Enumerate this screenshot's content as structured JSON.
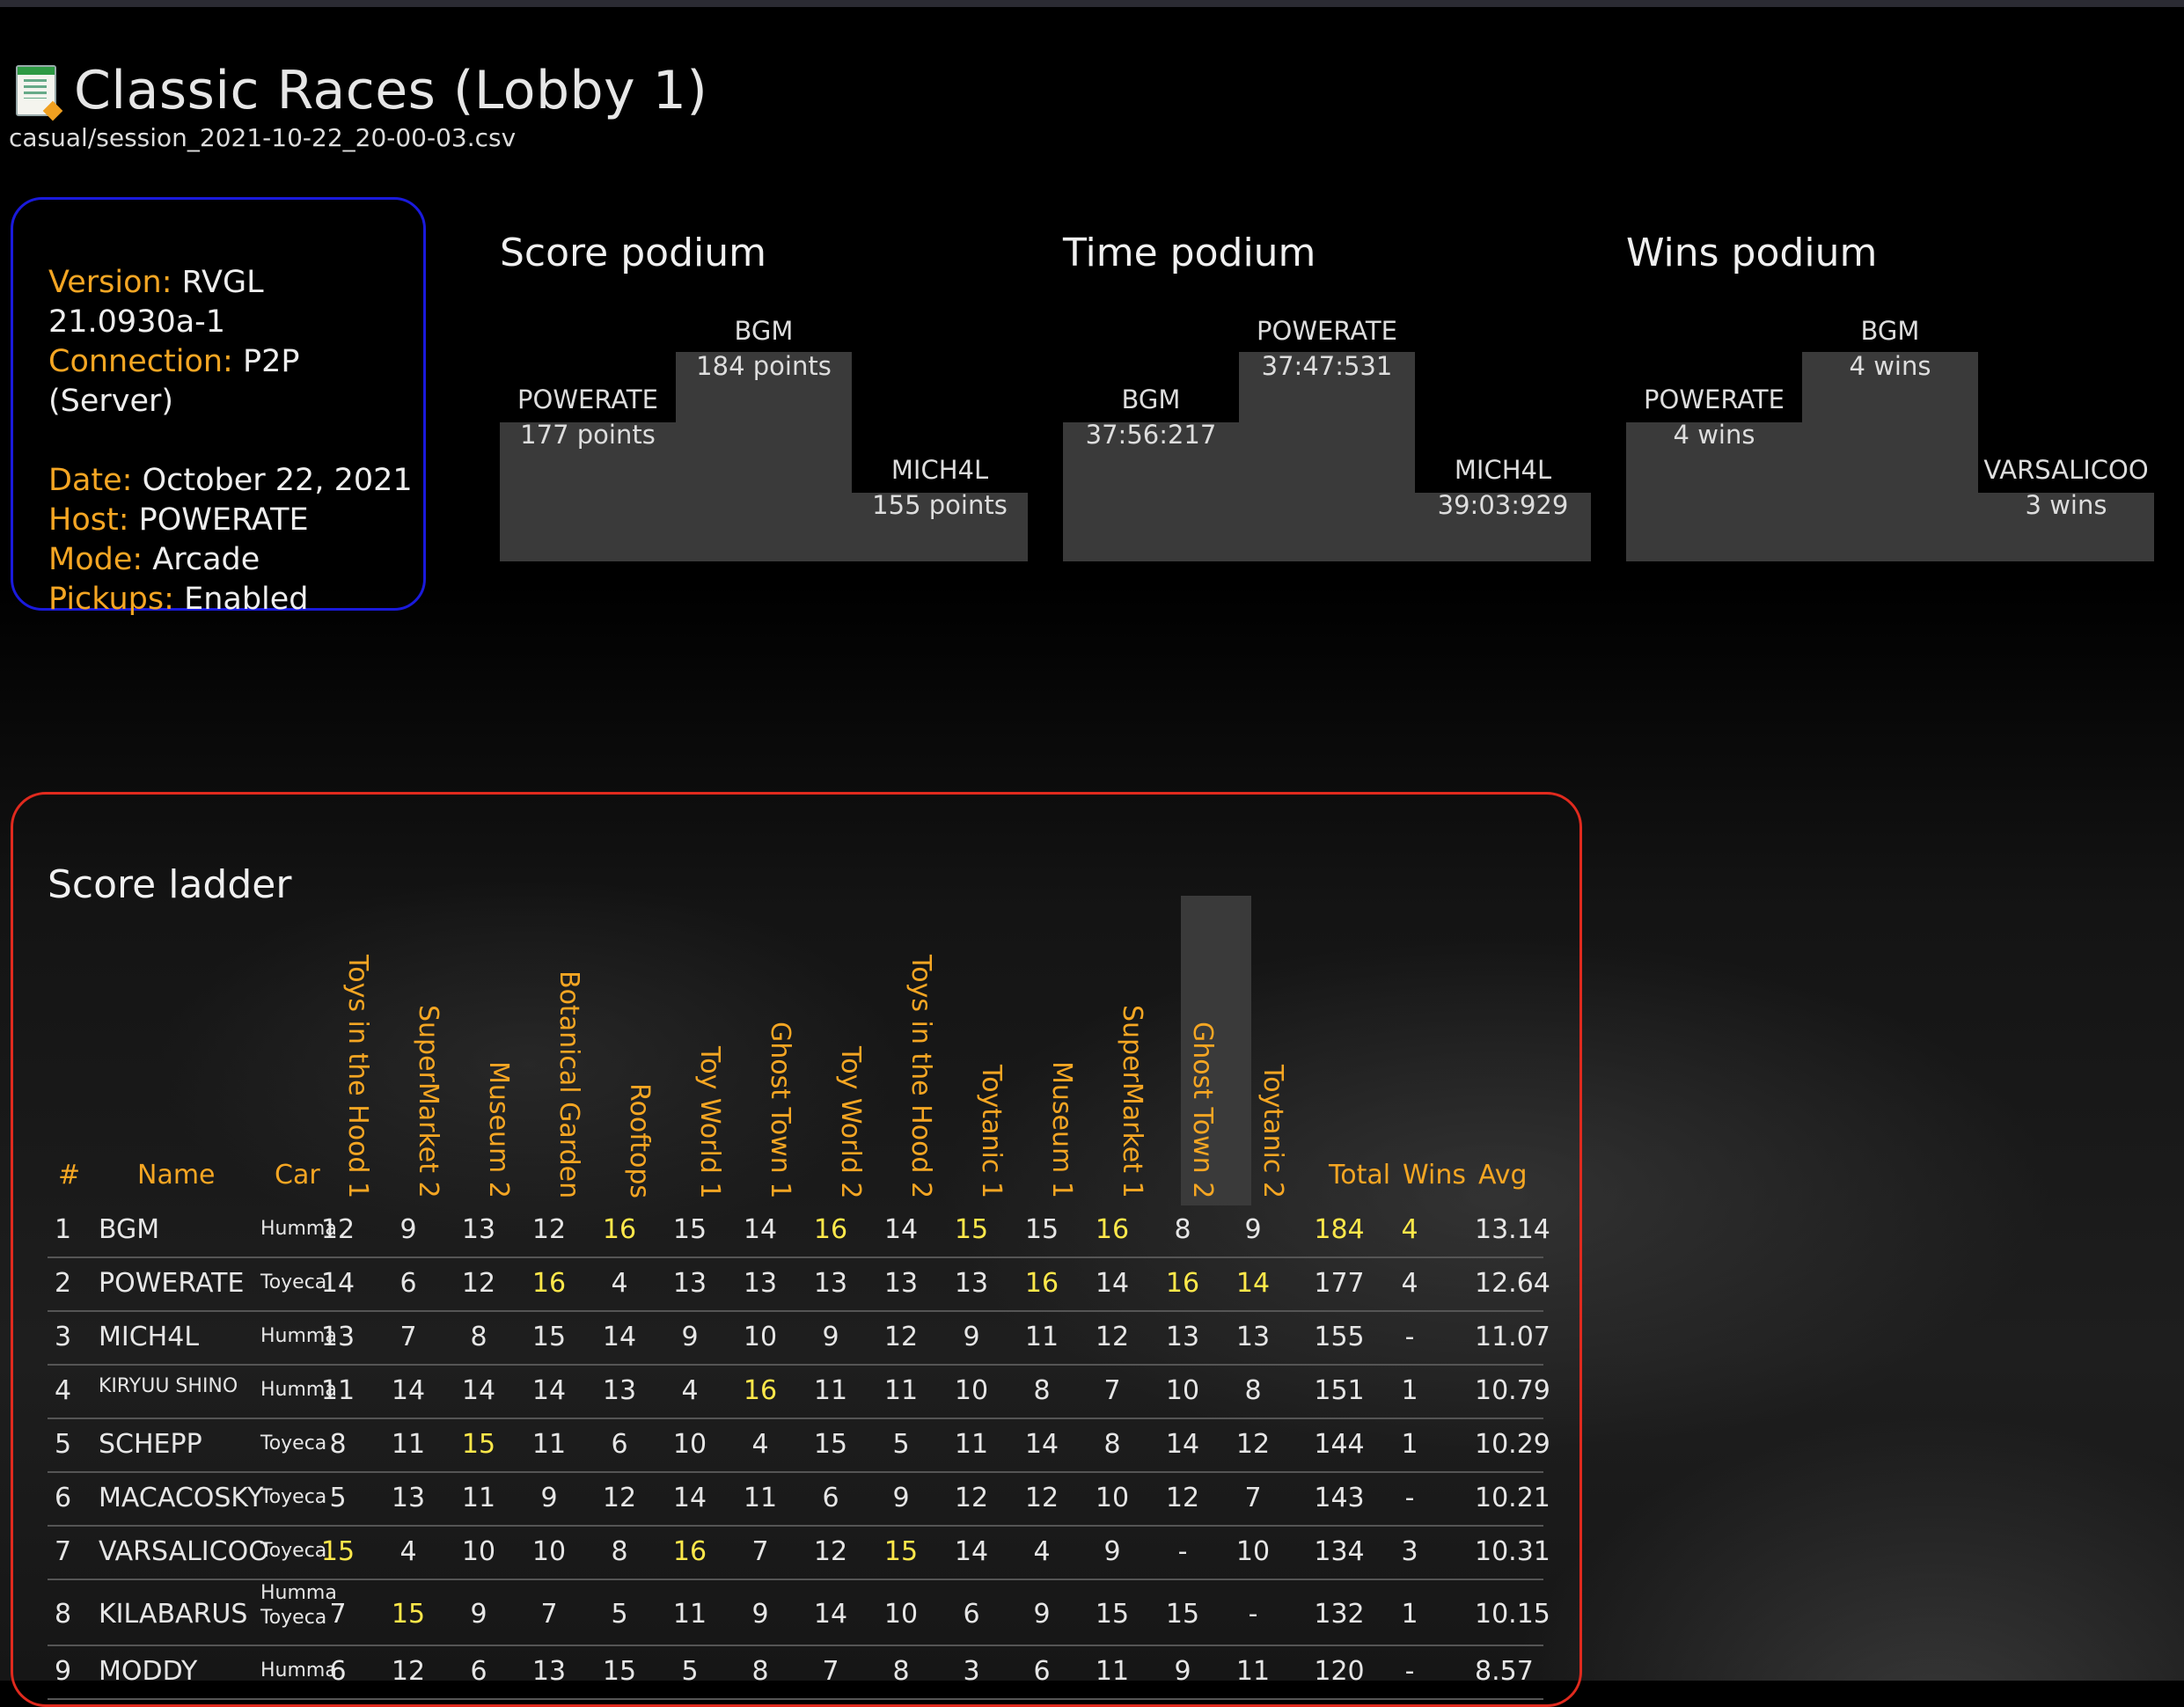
{
  "header": {
    "title": "Classic Races (Lobby 1)",
    "file_path": "casual/session_2021-10-22_20-00-03.csv",
    "file_icon": "spreadsheet-icon"
  },
  "info": {
    "version_label": "Version:",
    "version": "RVGL 21.0930a-1",
    "connection_label": "Connection:",
    "connection": "P2P (Server)",
    "date_label": "Date:",
    "date": "October 22, 2021",
    "host_label": "Host:",
    "host": "POWERATE",
    "mode_label": "Mode:",
    "mode": "Arcade",
    "pickups_label": "Pickups:",
    "pickups": "Enabled"
  },
  "podiums": {
    "score": {
      "title": "Score podium",
      "first": {
        "name": "BGM",
        "value": "184 points"
      },
      "second": {
        "name": "POWERATE",
        "value": "177 points"
      },
      "third": {
        "name": "MICH4L",
        "value": "155 points"
      }
    },
    "time": {
      "title": "Time podium",
      "first": {
        "name": "POWERATE",
        "value": "37:47:531"
      },
      "second": {
        "name": "BGM",
        "value": "37:56:217"
      },
      "third": {
        "name": "MICH4L",
        "value": "39:03:929"
      }
    },
    "wins": {
      "title": "Wins podium",
      "first": {
        "name": "BGM",
        "value": "4 wins"
      },
      "second": {
        "name": "POWERATE",
        "value": "4 wins"
      },
      "third": {
        "name": "VARSALICOO",
        "value": "3 wins"
      }
    }
  },
  "ladder": {
    "title": "Score ladder",
    "headers": {
      "rank": "#",
      "name": "Name",
      "car": "Car",
      "total": "Total",
      "wins": "Wins",
      "avg": "Avg"
    },
    "tracks": [
      "Toys in the Hood 1",
      "SuperMarket 2",
      "Museum 2",
      "Botanical Garden",
      "Rooftops",
      "Toy World 1",
      "Ghost Town 1",
      "Toy World 2",
      "Toys in the Hood 2",
      "Toytanic 1",
      "Museum 1",
      "SuperMarket 1",
      "Ghost Town 2",
      "Toytanic 2"
    ],
    "highlight_color": "#ffe84a",
    "rows": [
      {
        "rank": "1",
        "name": "BGM",
        "car": "Humma",
        "car2": "",
        "scores": [
          "12",
          "9",
          "13",
          "12",
          "16",
          "15",
          "14",
          "16",
          "14",
          "15",
          "15",
          "16",
          "8",
          "9"
        ],
        "hi": [
          4,
          7,
          9,
          11
        ],
        "total": "184",
        "wins": "4",
        "avg": "13.14",
        "total_hi": true
      },
      {
        "rank": "2",
        "name": "POWERATE",
        "car": "Toyeca",
        "car2": "",
        "scores": [
          "14",
          "6",
          "12",
          "16",
          "4",
          "13",
          "13",
          "13",
          "13",
          "13",
          "16",
          "14",
          "16",
          "14"
        ],
        "hi": [
          3,
          10,
          12,
          13
        ],
        "total": "177",
        "wins": "4",
        "avg": "12.64",
        "total_hi": false
      },
      {
        "rank": "3",
        "name": "MICH4L",
        "car": "Humma",
        "car2": "",
        "scores": [
          "13",
          "7",
          "8",
          "15",
          "14",
          "9",
          "10",
          "9",
          "12",
          "9",
          "11",
          "12",
          "13",
          "13"
        ],
        "hi": [],
        "total": "155",
        "wins": "-",
        "avg": "11.07",
        "total_hi": false
      },
      {
        "rank": "4",
        "name": "KIRYUU SHINO",
        "car": "Humma",
        "car2": "",
        "scores": [
          "11",
          "14",
          "14",
          "14",
          "13",
          "4",
          "16",
          "11",
          "11",
          "10",
          "8",
          "7",
          "10",
          "8"
        ],
        "hi": [
          6
        ],
        "total": "151",
        "wins": "1",
        "avg": "10.79",
        "total_hi": false
      },
      {
        "rank": "5",
        "name": "SCHEPP",
        "car": "Toyeca",
        "car2": "",
        "scores": [
          "8",
          "11",
          "15",
          "11",
          "6",
          "10",
          "4",
          "15",
          "5",
          "11",
          "14",
          "8",
          "14",
          "12"
        ],
        "hi": [
          2
        ],
        "total": "144",
        "wins": "1",
        "avg": "10.29",
        "total_hi": false
      },
      {
        "rank": "6",
        "name": "MACACOSKY",
        "car": "Toyeca",
        "car2": "",
        "scores": [
          "5",
          "13",
          "11",
          "9",
          "12",
          "14",
          "11",
          "6",
          "9",
          "12",
          "12",
          "10",
          "12",
          "7"
        ],
        "hi": [],
        "total": "143",
        "wins": "-",
        "avg": "10.21",
        "total_hi": false
      },
      {
        "rank": "7",
        "name": "VARSALICOO",
        "car": "Toyeca",
        "car2": "",
        "scores": [
          "15",
          "4",
          "10",
          "10",
          "8",
          "16",
          "7",
          "12",
          "15",
          "14",
          "4",
          "9",
          "-",
          "10"
        ],
        "hi": [
          0,
          5,
          8
        ],
        "total": "134",
        "wins": "3",
        "avg": "10.31",
        "total_hi": false
      },
      {
        "rank": "8",
        "name": "KILABARUS",
        "car": "Humma",
        "car2": "Toyeca",
        "scores": [
          "7",
          "15",
          "9",
          "7",
          "5",
          "11",
          "9",
          "14",
          "10",
          "6",
          "9",
          "15",
          "15",
          "-"
        ],
        "hi": [
          1
        ],
        "total": "132",
        "wins": "1",
        "avg": "10.15",
        "total_hi": false
      },
      {
        "rank": "9",
        "name": "MODDY",
        "car": "Humma",
        "car2": "",
        "scores": [
          "6",
          "12",
          "6",
          "13",
          "15",
          "5",
          "8",
          "7",
          "8",
          "3",
          "6",
          "11",
          "9",
          "11"
        ],
        "hi": [],
        "total": "120",
        "wins": "-",
        "avg": "8.57",
        "total_hi": false
      }
    ]
  }
}
